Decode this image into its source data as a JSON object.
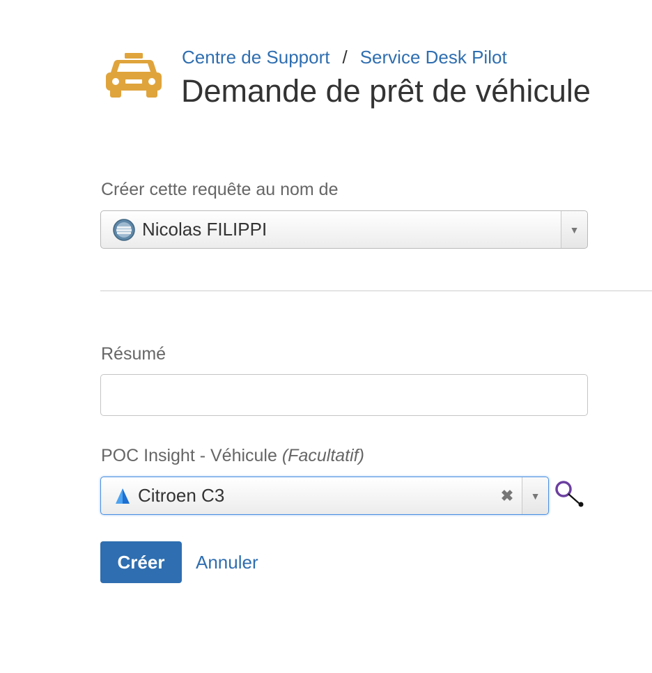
{
  "header": {
    "icon": "taxi-icon",
    "icon_color": "#e0a43c",
    "breadcrumb": [
      {
        "label": "Centre de Support"
      },
      {
        "label": "Service Desk Pilot"
      }
    ],
    "separator": "/",
    "title": "Demande de prêt de véhicule"
  },
  "form": {
    "reporter": {
      "label": "Créer cette requête au nom de",
      "value": "Nicolas FILIPPI",
      "avatar": "user-avatar"
    },
    "summary": {
      "label": "Résumé",
      "value": "",
      "placeholder": ""
    },
    "vehicle": {
      "label": "POC Insight - Véhicule",
      "optional_label": "(Facultatif)",
      "value": "Citroen C3",
      "icon": "insight-object-icon",
      "clear_glyph": "✖",
      "search_icon": "object-search-icon"
    },
    "dropdown_glyph": "▼"
  },
  "actions": {
    "submit_label": "Créer",
    "cancel_label": "Annuler"
  },
  "colors": {
    "link": "#2f6eb0",
    "primary_button": "#2f6eb0",
    "focus_border": "#4a90e2"
  }
}
